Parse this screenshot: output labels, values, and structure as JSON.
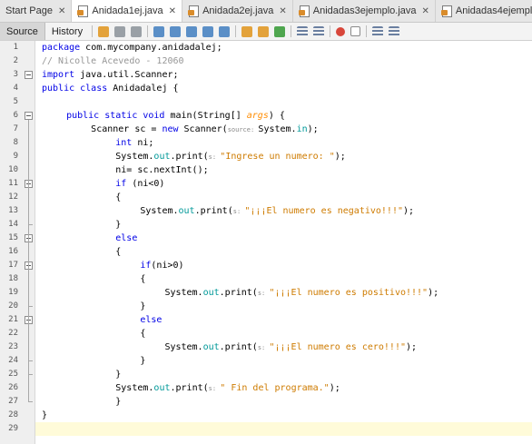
{
  "tabs": [
    {
      "label": "Start Page",
      "active": false,
      "has_icon": false
    },
    {
      "label": "Anidada1ej.java",
      "active": true,
      "has_icon": true
    },
    {
      "label": "Anidada2ej.java",
      "active": false,
      "has_icon": true
    },
    {
      "label": "Anidadas3ejemplo.java",
      "active": false,
      "has_icon": true
    },
    {
      "label": "Anidadas4ejemplo.java",
      "active": false,
      "has_icon": true
    }
  ],
  "toolbar": {
    "source_label": "Source",
    "history_label": "History",
    "icons": [
      "toggle-bookmark-icon",
      "back-icon",
      "forward-icon",
      "find-icon",
      "find-previous-icon",
      "find-next-icon",
      "find-selection-icon",
      "toggle-highlight-icon",
      "previous-bookmark-icon",
      "next-bookmark-icon",
      "toggle-bookmarks-icon",
      "shift-left-icon",
      "shift-right-icon",
      "start-macro-icon",
      "stop-macro-icon",
      "comment-icon",
      "uncomment-icon"
    ]
  },
  "colors": {
    "keyword": "#0000e6",
    "string": "#ce7b00",
    "comment": "#969696",
    "field": "#009999",
    "current_line": "#fffbd9"
  },
  "line_numbers": [
    "1",
    "2",
    "3",
    "4",
    "5",
    "6",
    "7",
    "8",
    "9",
    "10",
    "11",
    "12",
    "13",
    "14",
    "15",
    "16",
    "17",
    "18",
    "19",
    "20",
    "21",
    "22",
    "23",
    "24",
    "25",
    "26",
    "27",
    "28",
    "29"
  ],
  "code_lines": [
    {
      "indent": 0,
      "tokens": [
        [
          "kw",
          "package"
        ],
        [
          "nm",
          " com.mycompany.anidadalej;"
        ]
      ]
    },
    {
      "indent": 0,
      "tokens": [
        [
          "cm",
          "// Nicolle Acevedo - 12060"
        ]
      ]
    },
    {
      "indent": 0,
      "tokens": [
        [
          "kw",
          "import"
        ],
        [
          "nm",
          " java.util.Scanner;"
        ]
      ]
    },
    {
      "indent": 0,
      "tokens": [
        [
          "kw",
          "public class"
        ],
        [
          "nm",
          " Anidadalej {"
        ]
      ]
    },
    {
      "indent": 0,
      "tokens": []
    },
    {
      "indent": 1,
      "tokens": [
        [
          "kw",
          "public static void"
        ],
        [
          "nm",
          " main(String[] "
        ],
        [
          "pm",
          "args"
        ],
        [
          "nm",
          ") {"
        ]
      ]
    },
    {
      "indent": 2,
      "tokens": [
        [
          "nm",
          "Scanner sc = "
        ],
        [
          "kw",
          "new"
        ],
        [
          "nm",
          " Scanner("
        ],
        [
          "hint",
          "source: "
        ],
        [
          "nm",
          "System."
        ],
        [
          "fl",
          "in"
        ],
        [
          "nm",
          ");"
        ]
      ]
    },
    {
      "indent": 3,
      "tokens": [
        [
          "kw",
          "int"
        ],
        [
          "nm",
          " ni;"
        ]
      ]
    },
    {
      "indent": 3,
      "tokens": [
        [
          "nm",
          "System."
        ],
        [
          "fl",
          "out"
        ],
        [
          "nm",
          ".print("
        ],
        [
          "hint",
          "s: "
        ],
        [
          "st",
          "\"Ingrese un numero: \""
        ],
        [
          "nm",
          ");"
        ]
      ]
    },
    {
      "indent": 3,
      "tokens": [
        [
          "nm",
          "ni= sc.nextInt();"
        ]
      ]
    },
    {
      "indent": 3,
      "tokens": [
        [
          "kw",
          "if"
        ],
        [
          "nm",
          " (ni<0)"
        ]
      ]
    },
    {
      "indent": 3,
      "tokens": [
        [
          "nm",
          "{"
        ]
      ]
    },
    {
      "indent": 4,
      "tokens": [
        [
          "nm",
          "System."
        ],
        [
          "fl",
          "out"
        ],
        [
          "nm",
          ".print("
        ],
        [
          "hint",
          "s: "
        ],
        [
          "st",
          "\"¡¡¡El numero es negativo!!!\""
        ],
        [
          "nm",
          ");"
        ]
      ]
    },
    {
      "indent": 3,
      "tokens": [
        [
          "nm",
          "}"
        ]
      ]
    },
    {
      "indent": 3,
      "tokens": [
        [
          "kw",
          "else"
        ]
      ]
    },
    {
      "indent": 3,
      "tokens": [
        [
          "nm",
          "{"
        ]
      ]
    },
    {
      "indent": 4,
      "tokens": [
        [
          "kw",
          "if"
        ],
        [
          "nm",
          "(ni>0)"
        ]
      ]
    },
    {
      "indent": 4,
      "tokens": [
        [
          "nm",
          "{"
        ]
      ]
    },
    {
      "indent": 5,
      "tokens": [
        [
          "nm",
          "System."
        ],
        [
          "fl",
          "out"
        ],
        [
          "nm",
          ".print("
        ],
        [
          "hint",
          "s: "
        ],
        [
          "st",
          "\"¡¡¡El numero es positivo!!!\""
        ],
        [
          "nm",
          ");"
        ]
      ]
    },
    {
      "indent": 4,
      "tokens": [
        [
          "nm",
          "}"
        ]
      ]
    },
    {
      "indent": 4,
      "tokens": [
        [
          "kw",
          "else"
        ]
      ]
    },
    {
      "indent": 4,
      "tokens": [
        [
          "nm",
          "{"
        ]
      ]
    },
    {
      "indent": 5,
      "tokens": [
        [
          "nm",
          "System."
        ],
        [
          "fl",
          "out"
        ],
        [
          "nm",
          ".print("
        ],
        [
          "hint",
          "s: "
        ],
        [
          "st",
          "\"¡¡¡El numero es cero!!!\""
        ],
        [
          "nm",
          ");"
        ]
      ]
    },
    {
      "indent": 4,
      "tokens": [
        [
          "nm",
          "}"
        ]
      ]
    },
    {
      "indent": 3,
      "tokens": [
        [
          "nm",
          "}"
        ]
      ]
    },
    {
      "indent": 3,
      "tokens": [
        [
          "nm",
          "System."
        ],
        [
          "fl",
          "out"
        ],
        [
          "nm",
          ".print("
        ],
        [
          "hint",
          "s: "
        ],
        [
          "st",
          "\" Fin del programa.\""
        ],
        [
          "nm",
          ");"
        ]
      ]
    },
    {
      "indent": 3,
      "tokens": [
        [
          "nm",
          "}"
        ]
      ]
    },
    {
      "indent": 0,
      "tokens": [
        [
          "nm",
          "}"
        ]
      ]
    },
    {
      "indent": 0,
      "tokens": []
    }
  ],
  "current_line": 29
}
